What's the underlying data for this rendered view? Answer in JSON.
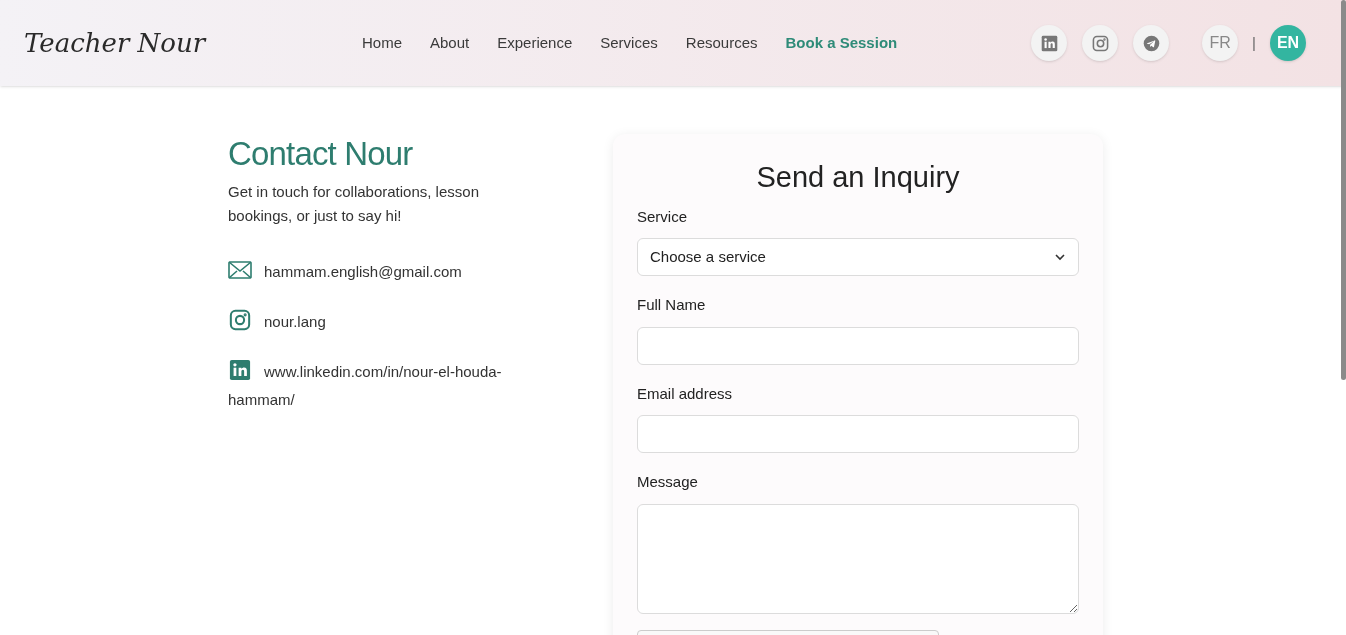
{
  "brand": "Teacher Nour",
  "nav": [
    {
      "label": "Home",
      "selected": false
    },
    {
      "label": "About",
      "selected": false
    },
    {
      "label": "Experience",
      "selected": false
    },
    {
      "label": "Services",
      "selected": false
    },
    {
      "label": "Resources",
      "selected": false
    },
    {
      "label": "Book a Session",
      "selected": true
    }
  ],
  "social": [
    {
      "kind": "linkedin"
    },
    {
      "kind": "instagram"
    },
    {
      "kind": "telegram"
    }
  ],
  "languages": [
    {
      "label": "FR",
      "selected": false
    },
    {
      "label": "EN",
      "selected": true
    }
  ],
  "language_separator": "|",
  "contact": {
    "title": "Contact Nour",
    "intro": "Get in touch for collaborations, lesson bookings, or just to say hi!",
    "items": [
      {
        "kind": "email",
        "text": "hammam.english@gmail.com"
      },
      {
        "kind": "instagram",
        "text": "nour.lang"
      },
      {
        "kind": "linkedin",
        "text": "www.linkedin.com/in/nour-el-houda-hammam/"
      }
    ]
  },
  "form": {
    "title": "Send an Inquiry",
    "fields": [
      {
        "kind": "select",
        "label": "Service",
        "value": "Choose a service"
      },
      {
        "kind": "text",
        "label": "Full Name"
      },
      {
        "kind": "text",
        "label": "Email address"
      },
      {
        "kind": "textarea",
        "label": "Message"
      }
    ]
  }
}
